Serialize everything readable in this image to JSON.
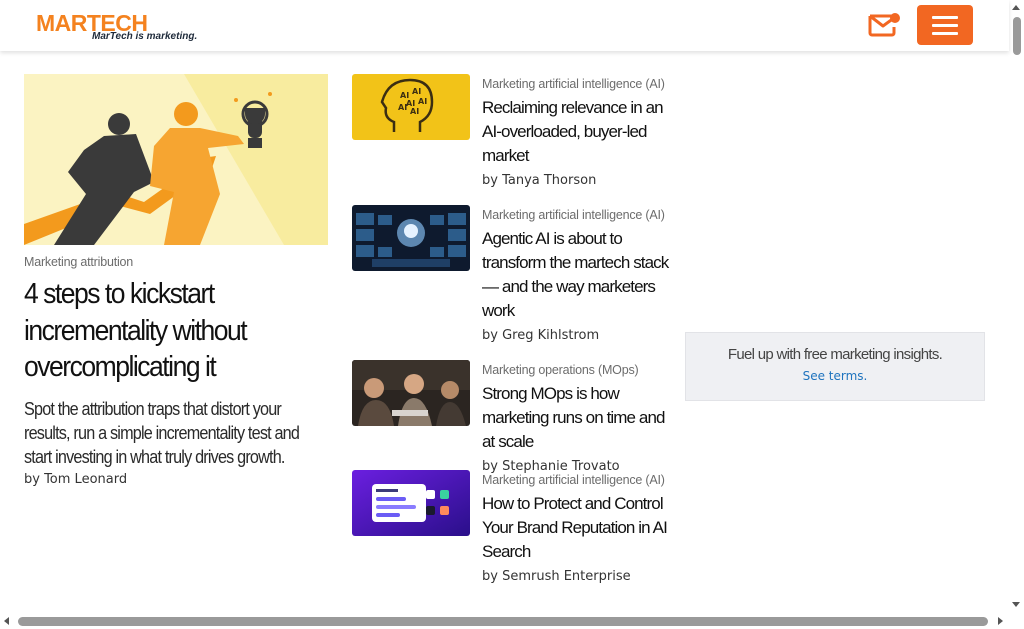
{
  "header": {
    "logo_word": "MARTECH",
    "logo_tagline": "MarTech is marketing.",
    "accent": "#f26722"
  },
  "feature": {
    "category": "Marketing attribution",
    "title": "4 steps to kickstart incrementality without overcomplicating it",
    "description": "Spot the attribution traps that distort your results, run a simple incrementality test and start investing in what truly drives growth.",
    "byline": "by Tom Leonard"
  },
  "articles": [
    {
      "category": "Marketing artificial intelligence (AI)",
      "title": "Reclaiming relevance in an AI-overloaded, buyer-led market",
      "byline": "by Tanya Thorson"
    },
    {
      "category": "Marketing artificial intelligence (AI)",
      "title": "Agentic AI is about to transform the martech stack — and the way marketers work",
      "byline": "by Greg Kihlstrom"
    },
    {
      "category": "Marketing operations (MOps)",
      "title": "Strong MOps is how marketing runs on time and at scale",
      "byline": "by Stephanie Trovato"
    },
    {
      "category": "Marketing artificial intelligence (AI)",
      "title": "How to Protect and Control Your Brand Reputation in AI Search",
      "byline": "by Semrush Enterprise"
    }
  ],
  "promo": {
    "text": "Fuel up with free marketing insights.",
    "link": "See terms."
  },
  "icons": {
    "mail": "envelope-icon",
    "menu": "hamburger-icon"
  }
}
